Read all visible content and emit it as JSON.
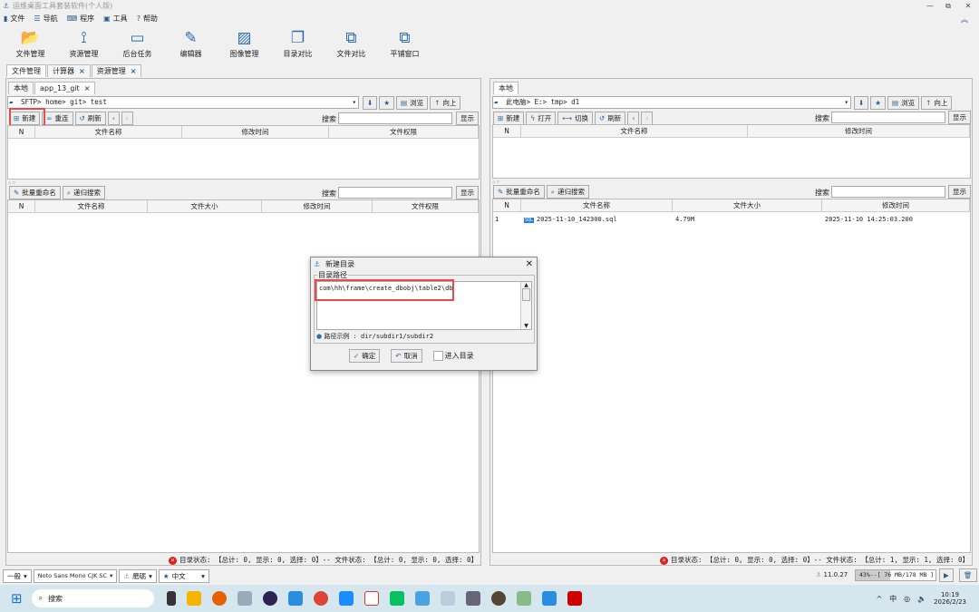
{
  "window": {
    "title": "运维桌面工具套装软件(个人版)",
    "min": "—",
    "max": "⧉",
    "close": "✕"
  },
  "menu": [
    {
      "icon": "file-icon",
      "label": "文件"
    },
    {
      "icon": "list-icon",
      "label": "导航"
    },
    {
      "icon": "keyboard-icon",
      "label": "程序"
    },
    {
      "icon": "toolbox-icon",
      "label": "工具"
    },
    {
      "icon": "help-icon",
      "label": "帮助"
    }
  ],
  "toolbar": [
    "文件管理",
    "资源管理",
    "后台任务",
    "编辑器",
    "图像管理",
    "目录对比",
    "文件对比",
    "平铺窗口"
  ],
  "outer_tabs": [
    "文件管理",
    "计算器",
    "资源管理"
  ],
  "left": {
    "tabs": [
      "本地",
      "app_13_git"
    ],
    "path": "SFTP> home> git> test",
    "nav_buttons": {
      "browse": "浏览",
      "up": "向上"
    },
    "buttons": [
      "新建",
      "重连",
      "刷新"
    ],
    "search_label": "搜索",
    "show": "显示",
    "dir_headers": [
      "N",
      "文件名称",
      "修改时间",
      "文件权限"
    ],
    "file_buttons": [
      "批量重命名",
      "递归搜索"
    ],
    "file_headers": [
      "N",
      "文件名称",
      "文件大小",
      "修改时间",
      "文件权限"
    ],
    "status": "目录状态: 【总计: 0, 显示: 0, 选择: 0】-- 文件状态: 【总计: 0, 显示: 0, 选择: 0】"
  },
  "right": {
    "tabs": [
      "本地"
    ],
    "path": "此电脑> E:> tmp> d1",
    "nav_buttons": {
      "browse": "浏览",
      "up": "向上"
    },
    "buttons": [
      "新建",
      "打开",
      "切换",
      "刷新"
    ],
    "search_label": "搜索",
    "show": "显示",
    "dir_headers": [
      "N",
      "文件名称",
      "修改时间"
    ],
    "file_buttons": [
      "批量重命名",
      "递归搜索"
    ],
    "file_headers": [
      "N",
      "文件名称",
      "文件大小",
      "修改时间"
    ],
    "files": [
      {
        "n": "1",
        "name": "2025-11-10_142300.sql",
        "size": "4.79M",
        "mtime": "2025-11-10 14:25:03.200"
      }
    ],
    "status": "目录状态: 【总计: 0, 显示: 0, 选择: 0】-- 文件状态: 【总计: 1, 显示: 1, 选择: 0】"
  },
  "dialog": {
    "title": "新建目录",
    "group": "目录路径",
    "value": "com\\hh\\frame\\create_dbobj\\table2\\db",
    "hint": "路径示例 : dir/subdir1/subdir2",
    "ok": "确定",
    "cancel": "取消",
    "enter": "进入目录",
    "enter_checked": false
  },
  "bottom": {
    "level": "一般",
    "font": "Noto Sans Mono CJK SC",
    "theme": "磨砺",
    "lang": "中文",
    "version": "11.0.27",
    "memory": "43%--[ 76 MB/178 MB ]",
    "memory_percent": 43
  },
  "taskbar": {
    "search": "搜索",
    "ime": "中",
    "time": "10:19",
    "date": "2026/2/23"
  }
}
